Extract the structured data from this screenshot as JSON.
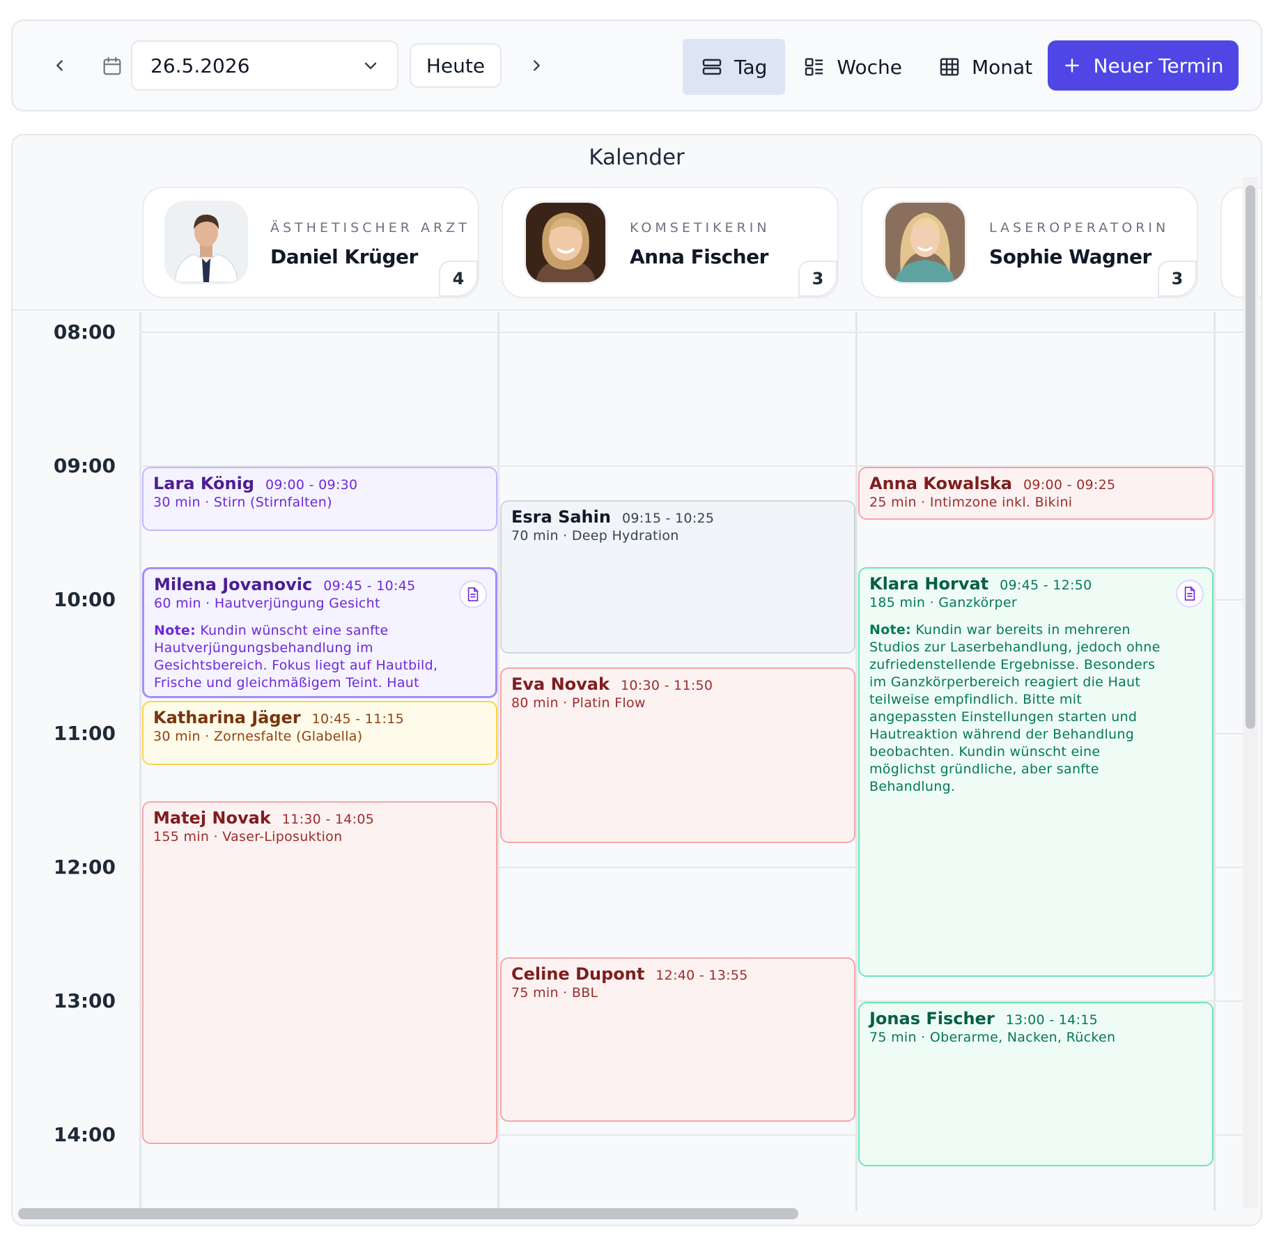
{
  "toolbar": {
    "date_value": "26.5.2026",
    "today_label": "Heute",
    "views": [
      {
        "label": "Tag",
        "icon": "day-view-icon",
        "active": true
      },
      {
        "label": "Woche",
        "icon": "week-view-icon",
        "active": false
      },
      {
        "label": "Monat",
        "icon": "month-view-icon",
        "active": false
      }
    ],
    "new_button_label": "Neuer Termin",
    "accent_color": "#4f46e5"
  },
  "calendar": {
    "title": "Kalender",
    "staff": [
      {
        "role": "ÄSTHETISCHER ARZT",
        "name": "Daniel Krüger",
        "count": "4"
      },
      {
        "role": "KOMSETIKERIN",
        "name": "Anna Fischer",
        "count": "3"
      },
      {
        "role": "LASEROPERATORIN",
        "name": "Sophie Wagner",
        "count": "3"
      }
    ],
    "hours": [
      "08:00",
      "09:00",
      "10:00",
      "11:00",
      "12:00",
      "13:00",
      "14:00"
    ],
    "appointments": [
      {
        "column": 0,
        "start": "09:00",
        "end_visual": "09:30",
        "name": "Lara König",
        "time": "09:00 - 09:30",
        "detail": "30 min · Stirn (Stirnfalten)",
        "color": "purple",
        "note_label": "",
        "note": ""
      },
      {
        "column": 0,
        "start": "09:45",
        "end_visual": "10:45",
        "name": "Milena Jovanovic",
        "time": "09:45 - 10:45",
        "detail": "60 min · Hautverjüngung Gesicht",
        "color": "purple",
        "note_label": "Note:",
        "note": "Kundin wünscht eine sanfte Hautverjüngungsbehandlung im Gesichtsbereich. Fokus liegt auf Hautbild, Frische und gleichmäßigem Teint. Haut"
      },
      {
        "column": 0,
        "start": "10:45",
        "end_visual": "11:15",
        "name": "Katharina Jäger",
        "time": "10:45 - 11:15",
        "detail": "30 min · Zornesfalte (Glabella)",
        "color": "yellow",
        "note_label": "",
        "note": ""
      },
      {
        "column": 0,
        "start": "11:30",
        "end_visual": "14:05",
        "name": "Matej Novak",
        "time": "11:30 - 14:05",
        "detail": "155 min · Vaser-Liposuktion",
        "color": "red",
        "note_label": "",
        "note": ""
      },
      {
        "column": 1,
        "start": "09:15",
        "end_visual": "10:25",
        "name": "Esra Sahin",
        "time": "09:15 - 10:25",
        "detail": "70 min · Deep Hydration",
        "color": "gray",
        "note_label": "",
        "note": ""
      },
      {
        "column": 1,
        "start": "10:30",
        "end_visual": "11:50",
        "name": "Eva Novak",
        "time": "10:30 - 11:50",
        "detail": "80 min · Platin Flow",
        "color": "red",
        "note_label": "",
        "note": ""
      },
      {
        "column": 1,
        "start": "12:40",
        "end_visual": "13:55",
        "name": "Celine Dupont",
        "time": "12:40 - 13:55",
        "detail": "75 min · BBL",
        "color": "red",
        "note_label": "",
        "note": ""
      },
      {
        "column": 2,
        "start": "09:00",
        "end_visual": "09:25",
        "name": "Anna Kowalska",
        "time": "09:00 - 09:25",
        "detail": "25 min · Intimzone inkl. Bikini",
        "color": "red",
        "note_label": "",
        "note": ""
      },
      {
        "column": 2,
        "start": "09:45",
        "end_visual": "12:50",
        "name": "Klara Horvat",
        "time": "09:45 - 12:50",
        "detail": "185 min · Ganzkörper",
        "color": "green",
        "note_label": "Note:",
        "note": "Kundin war bereits in mehreren Studios zur Laserbehandlung, jedoch ohne zufriedenstellende Ergebnisse. Besonders im Ganzkörperbereich reagiert die Haut teilweise empfindlich. Bitte mit angepassten Einstellungen starten und Hautreaktion während der Behandlung beobachten. Kundin wünscht eine möglichst gründliche, aber sanfte Behandlung."
      },
      {
        "column": 2,
        "start": "13:00",
        "end_visual": "14:15",
        "name": "Jonas Fischer",
        "time": "13:00 - 14:15",
        "detail": "75 min · Oberarme, Nacken, Rücken",
        "color": "green",
        "note_label": "",
        "note": ""
      }
    ]
  }
}
